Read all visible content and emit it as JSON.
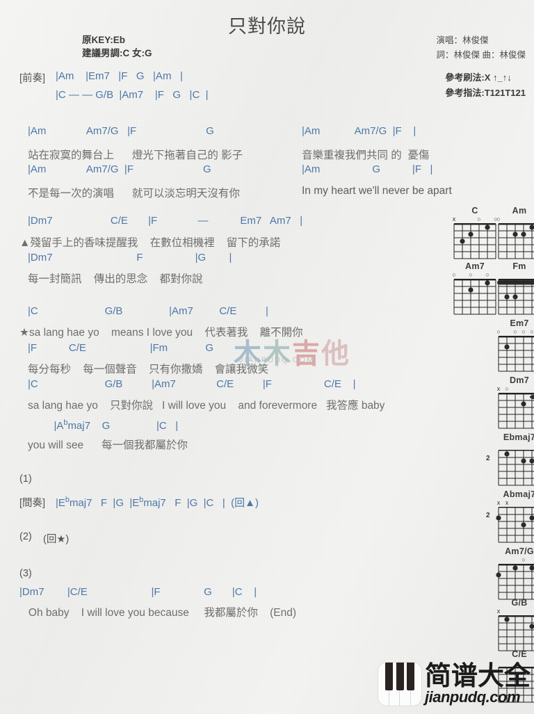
{
  "header": {
    "title": "只對你說",
    "original_key": "原KEY:Eb",
    "suggested_key": "建議男調:C 女:G",
    "singer": "演唱：林俊傑",
    "writer_composer": "詞：林俊傑  曲：林俊傑",
    "strum_ref": "參考刷法:X ↑_↑↓",
    "finger_ref": "參考指法:T121T121"
  },
  "sections": {
    "intro_label": "[前奏]",
    "intro_line1": "|Am    |Em7   |F   G   |Am   |",
    "intro_line2": "|C — — G/B  |Am7    |F   G   |C  |",
    "v1_chords_1": "|Am              Am7/G   |F                        G",
    "v1_chords_1b": "|Am            Am7/G  |F    |",
    "v1_lyric_1": "站在寂寞的舞台上      燈光下拖著自己的 影子",
    "v1_lyric_1b": "音樂重複我們共同 的  憂傷",
    "v1_chords_2": "|Am              Am7/G  |F                        G",
    "v1_chords_2b": "|Am                  G           |F   |",
    "v1_lyric_2": "不是每一次的演唱      就可以淡忘明天沒有你",
    "v1_lyric_2b": "In my heart we'll never be apart",
    "b_chords_1": "|Dm7                    C/E       |F              —           Em7   Am7   |",
    "b_lyric_1": "▲殘留手上的香味提醒我    在數位相機裡    留下的承諾",
    "b_chords_2": "|Dm7                             F                  |G        |",
    "b_lyric_2": "每一封簡訊    傳出的思念    都對你說",
    "c_chords_1": "|C                       G/B                |Am7         C/E          |",
    "c_lyric_1": "★sa lang hae yo    means I love you    代表著我    離不開你",
    "c_chords_2": "|F           C/E                      |Fm             G",
    "c_lyric_2": "每分每秒    每一個聲音    只有你撒嬌    會讓我微笑",
    "c_chords_3": "|C                       G/B          |Am7              C/E          |F                  C/E    |",
    "c_lyric_3": "sa lang hae yo    只對你說   I will love you    and forevermore   我答應 baby",
    "c_chords_4": "         |A♭maj7    G                |C   |",
    "c_lyric_4": "you will see      每一個我都屬於你",
    "ending1_num": "(1)",
    "ending1_label": "[間奏]",
    "ending1_chords": "|E♭maj7   F  |G  |E♭maj7   F  |G  |C   |  (回▲)",
    "ending2_num": "(2)",
    "ending2_text": "(回★)",
    "ending3_num": "(3)",
    "ending3_chords": "|Dm7        |C/E                      |F               G       |C    |",
    "ending3_lyric": "   Oh baby    I will love you because     我都屬於你    (End)"
  },
  "watermark": {
    "chars": [
      "木",
      "木",
      "吉",
      "他"
    ],
    "sub": "JIANPUDQ.COM"
  },
  "chord_diagrams": [
    {
      "name": "C",
      "marks": [
        "x",
        "",
        "",
        "o",
        "",
        "o"
      ],
      "fret_label": "",
      "dots": [
        [
          5,
          3
        ],
        [
          4,
          2
        ],
        [
          2,
          1
        ]
      ],
      "barre": null
    },
    {
      "name": "Am",
      "marks": [
        "o",
        "",
        "",
        "",
        "",
        "o"
      ],
      "fret_label": "",
      "dots": [
        [
          4,
          2
        ],
        [
          3,
          2
        ],
        [
          2,
          1
        ]
      ],
      "barre": null
    },
    {
      "name": "Am7",
      "marks": [
        "o",
        "",
        "o",
        "",
        "o",
        ""
      ],
      "fret_label": "",
      "dots": [
        [
          4,
          2
        ],
        [
          2,
          1
        ]
      ],
      "barre": null
    },
    {
      "name": "Fm",
      "marks": [
        "",
        "",
        "",
        "",
        "",
        ""
      ],
      "fret_label": "",
      "dots": [
        [
          5,
          3
        ],
        [
          4,
          3
        ]
      ],
      "barre": 1
    },
    {
      "name": "Em7",
      "marks": [
        "o",
        "",
        "o",
        "o",
        "o",
        "o"
      ],
      "fret_label": "",
      "dots": [
        [
          5,
          2
        ]
      ],
      "barre": null
    },
    {
      "name": "Dm7",
      "marks": [
        "x",
        "o",
        "",
        "",
        "",
        ""
      ],
      "fret_label": "",
      "dots": [
        [
          3,
          2
        ]
      ],
      "barre": "top-right"
    },
    {
      "name": "Ebmaj7",
      "marks": [
        "",
        "",
        "",
        "",
        "",
        ""
      ],
      "fret_label": "2",
      "dots": [
        [
          5,
          1
        ],
        [
          3,
          2
        ],
        [
          2,
          2
        ],
        [
          1,
          2
        ]
      ],
      "barre": null
    },
    {
      "name": "Abmaj7",
      "marks": [
        "x",
        "x",
        "",
        "",
        "",
        ""
      ],
      "fret_label": "2",
      "dots": [
        [
          6,
          2
        ],
        [
          3,
          3
        ],
        [
          2,
          2
        ],
        [
          1,
          1
        ]
      ],
      "barre": null
    },
    {
      "name": "Am7/G",
      "marks": [
        "",
        "",
        "",
        "o",
        "",
        ""
      ],
      "fret_label": "",
      "dots": [
        [
          6,
          2
        ],
        [
          4,
          1
        ],
        [
          2,
          1
        ]
      ],
      "barre": null
    },
    {
      "name": "G/B",
      "marks": [
        "x",
        "",
        "",
        "",
        "",
        ""
      ],
      "fret_label": "",
      "dots": [
        [
          5,
          1
        ],
        [
          2,
          2
        ]
      ],
      "barre": null
    },
    {
      "name": "C/E",
      "marks": [
        "",
        "",
        "",
        "",
        "",
        ""
      ],
      "fret_label": "",
      "dots": [],
      "barre": null
    }
  ],
  "logo": {
    "name_cn": "简谱大全",
    "url": "jianpudq.com"
  }
}
